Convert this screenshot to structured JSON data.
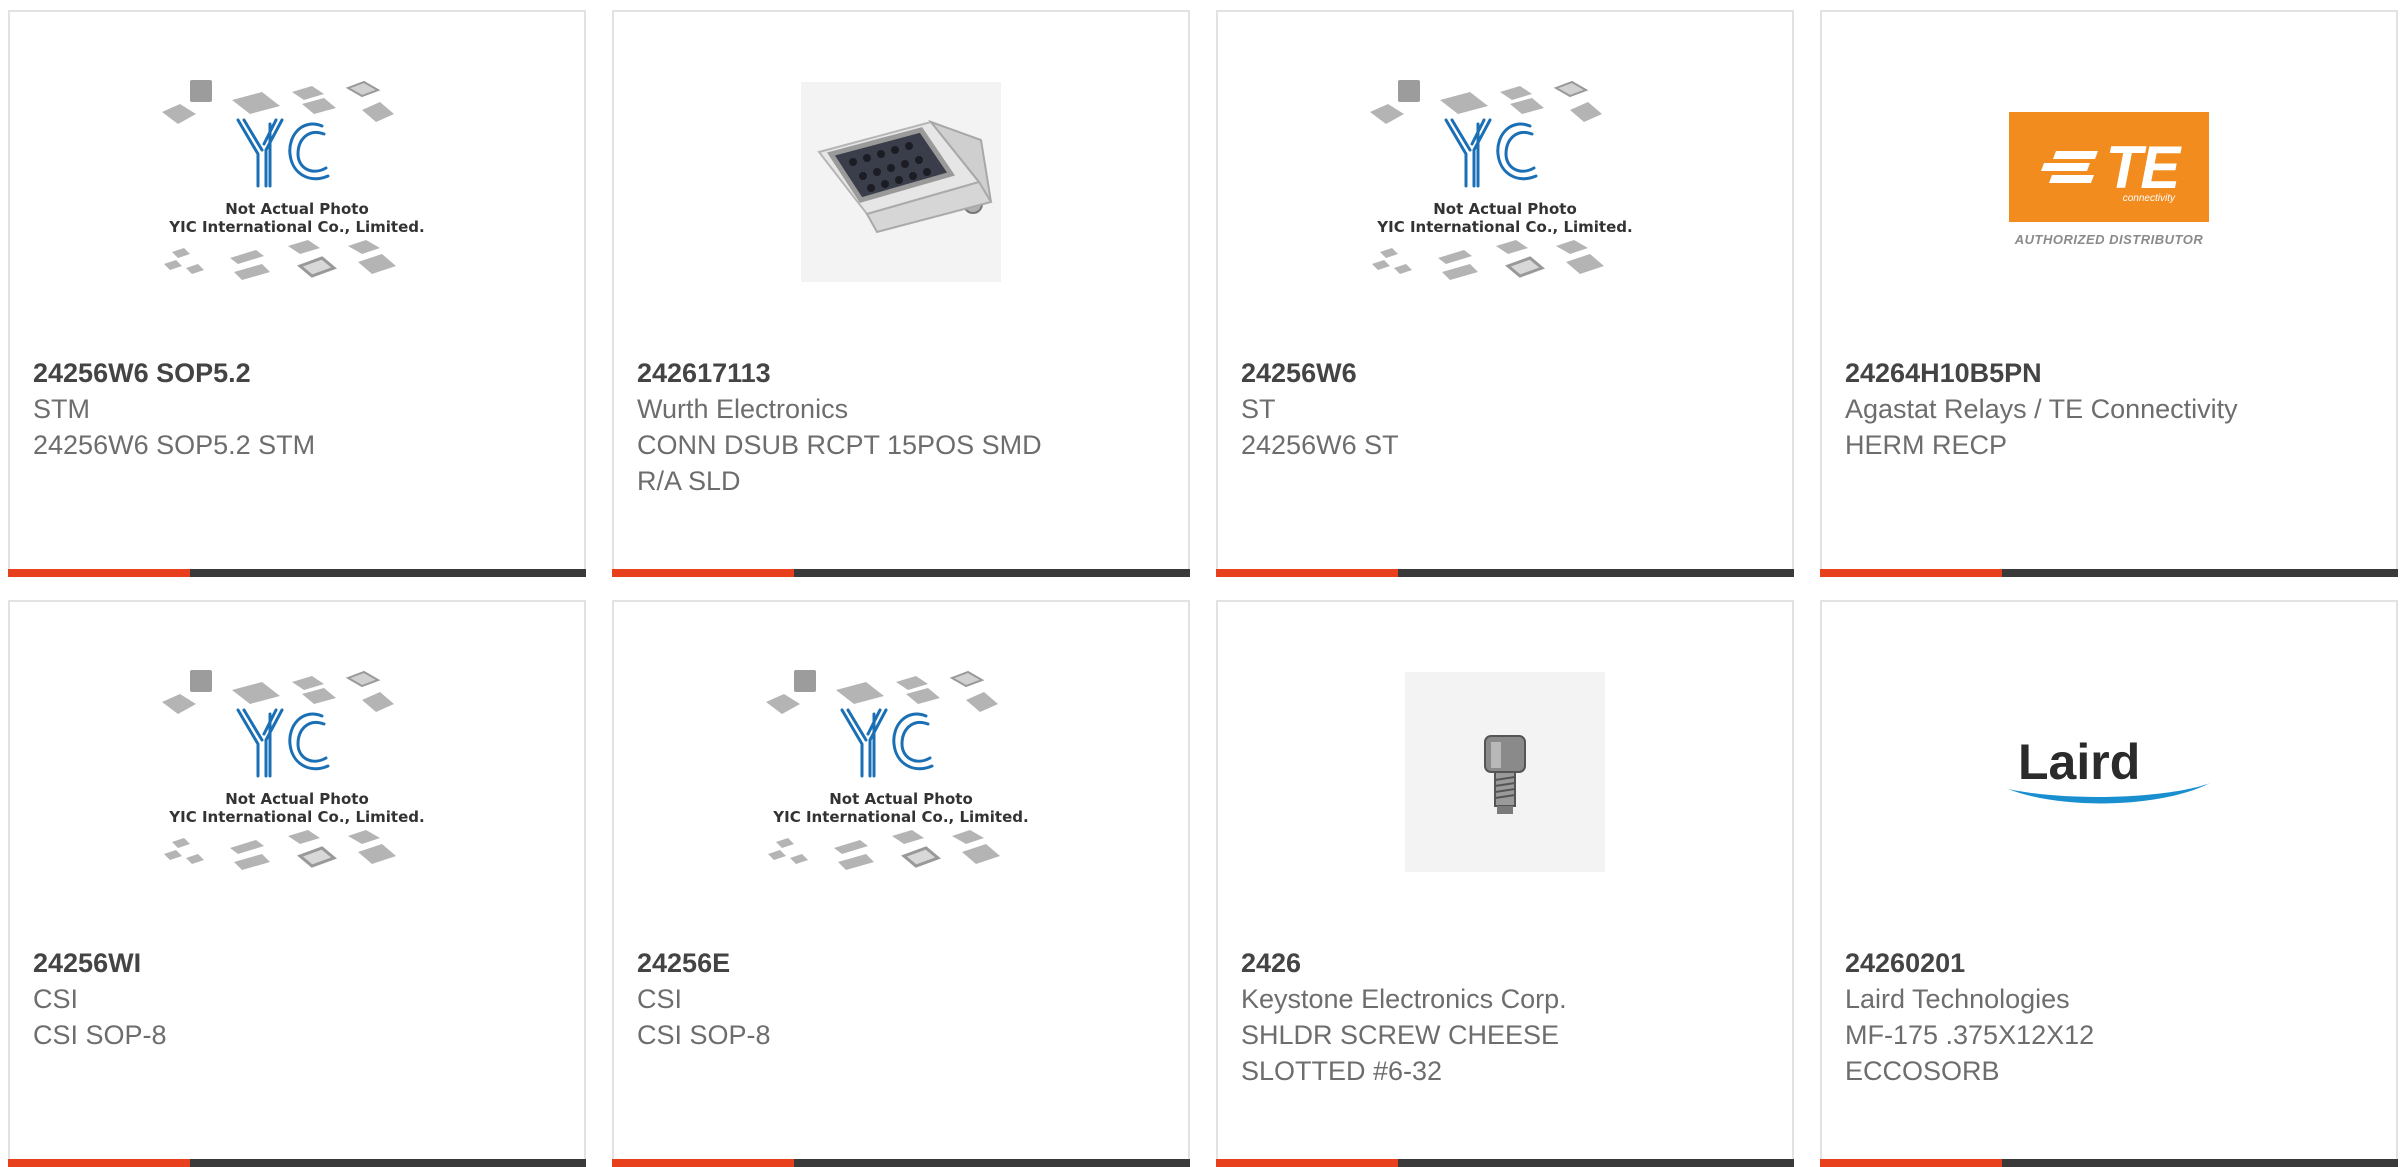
{
  "placeholder": {
    "line1": "Not Actual Photo",
    "line2": "YIC International Co., Limited."
  },
  "logos": {
    "te": {
      "word": "TE",
      "sub": "connectivity",
      "auth": "AUTHORIZED DISTRIBUTOR"
    },
    "laird": {
      "word": "Laird"
    }
  },
  "colors": {
    "accent": "#e8401c",
    "bar": "#3a3a3a",
    "border": "#e2e2e2",
    "te_orange": "#f28c1f",
    "yic_blue": "#1a6fb5"
  },
  "products": [
    {
      "part_number": "24256W6 SOP5.2",
      "manufacturer": "STM",
      "description": "24256W6 SOP5.2 STM",
      "image": "yic-placeholder"
    },
    {
      "part_number": "242617113",
      "manufacturer": "Wurth Electronics",
      "description": "CONN DSUB RCPT 15POS SMD\nR/A SLD",
      "image": "dsub-connector-photo"
    },
    {
      "part_number": "24256W6",
      "manufacturer": "ST",
      "description": "24256W6 ST",
      "image": "yic-placeholder"
    },
    {
      "part_number": "24264H10B5PN",
      "manufacturer": "Agastat Relays / TE Connectivity",
      "description": "HERM RECP",
      "image": "te-connectivity-logo"
    },
    {
      "part_number": "24256WI",
      "manufacturer": "CSI",
      "description": "CSI SOP-8",
      "image": "yic-placeholder"
    },
    {
      "part_number": "24256E",
      "manufacturer": "CSI",
      "description": "CSI SOP-8",
      "image": "yic-placeholder"
    },
    {
      "part_number": "2426",
      "manufacturer": "Keystone Electronics Corp.",
      "description": "SHLDR SCREW CHEESE\nSLOTTED #6-32",
      "image": "screw-photo"
    },
    {
      "part_number": "24260201",
      "manufacturer": "Laird Technologies",
      "description": "MF-175 .375X12X12\nECCOSORB",
      "image": "laird-logo"
    }
  ]
}
